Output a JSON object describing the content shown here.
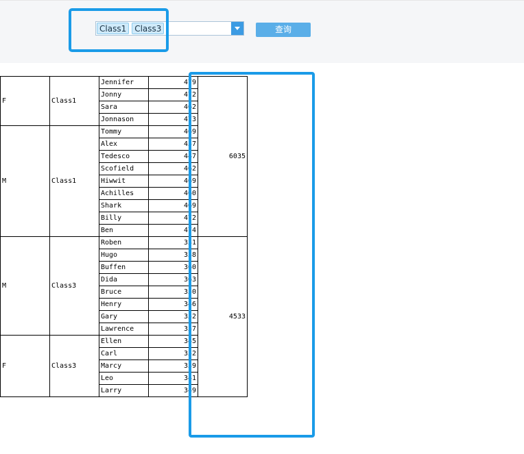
{
  "filter": {
    "selected_tags": [
      "Class1",
      "Class3"
    ],
    "query_label": "查询"
  },
  "report": {
    "groups": [
      {
        "gender": "F",
        "class": "Class1",
        "rows": [
          [
            "Jennifer",
            "479"
          ],
          [
            "Jonny",
            "472"
          ],
          [
            "Sara",
            "462"
          ],
          [
            "Jonnason",
            "473"
          ]
        ]
      },
      {
        "gender": "M",
        "class": "Class1",
        "rows": [
          [
            "Tommy",
            "469"
          ],
          [
            "Alex",
            "457"
          ],
          [
            "Tedesco",
            "447"
          ],
          [
            "Scofield",
            "462"
          ],
          [
            "Hiwwit",
            "469"
          ],
          [
            "Achilles",
            "460"
          ],
          [
            "Shark",
            "469"
          ],
          [
            "Billy",
            "472"
          ],
          [
            "Ben",
            "474"
          ]
        ]
      },
      {
        "gender": "M",
        "class": "Class3",
        "rows": [
          [
            "Roben",
            "331"
          ],
          [
            "Hugo",
            "338"
          ],
          [
            "Buffen",
            "360"
          ],
          [
            "Dida",
            "363"
          ],
          [
            "Bruce",
            "350"
          ],
          [
            "Henry",
            "346"
          ],
          [
            "Gary",
            "352"
          ],
          [
            "Lawrence",
            "357"
          ]
        ]
      },
      {
        "gender": "F",
        "class": "Class3",
        "rows": [
          [
            "Ellen",
            "345"
          ],
          [
            "Carl",
            "352"
          ],
          [
            "Marcy",
            "339"
          ],
          [
            "Leo",
            "341"
          ],
          [
            "Larry",
            "349"
          ]
        ]
      }
    ],
    "class_totals": [
      {
        "class": "Class1",
        "total": "6035",
        "span_groups": 2
      },
      {
        "class": "Class3",
        "total": "4533",
        "span_groups": 2
      }
    ]
  },
  "colors": {
    "accent": "#1a9be8",
    "tag_bg": "#cfeafa",
    "button_bg": "#5aaee8"
  }
}
